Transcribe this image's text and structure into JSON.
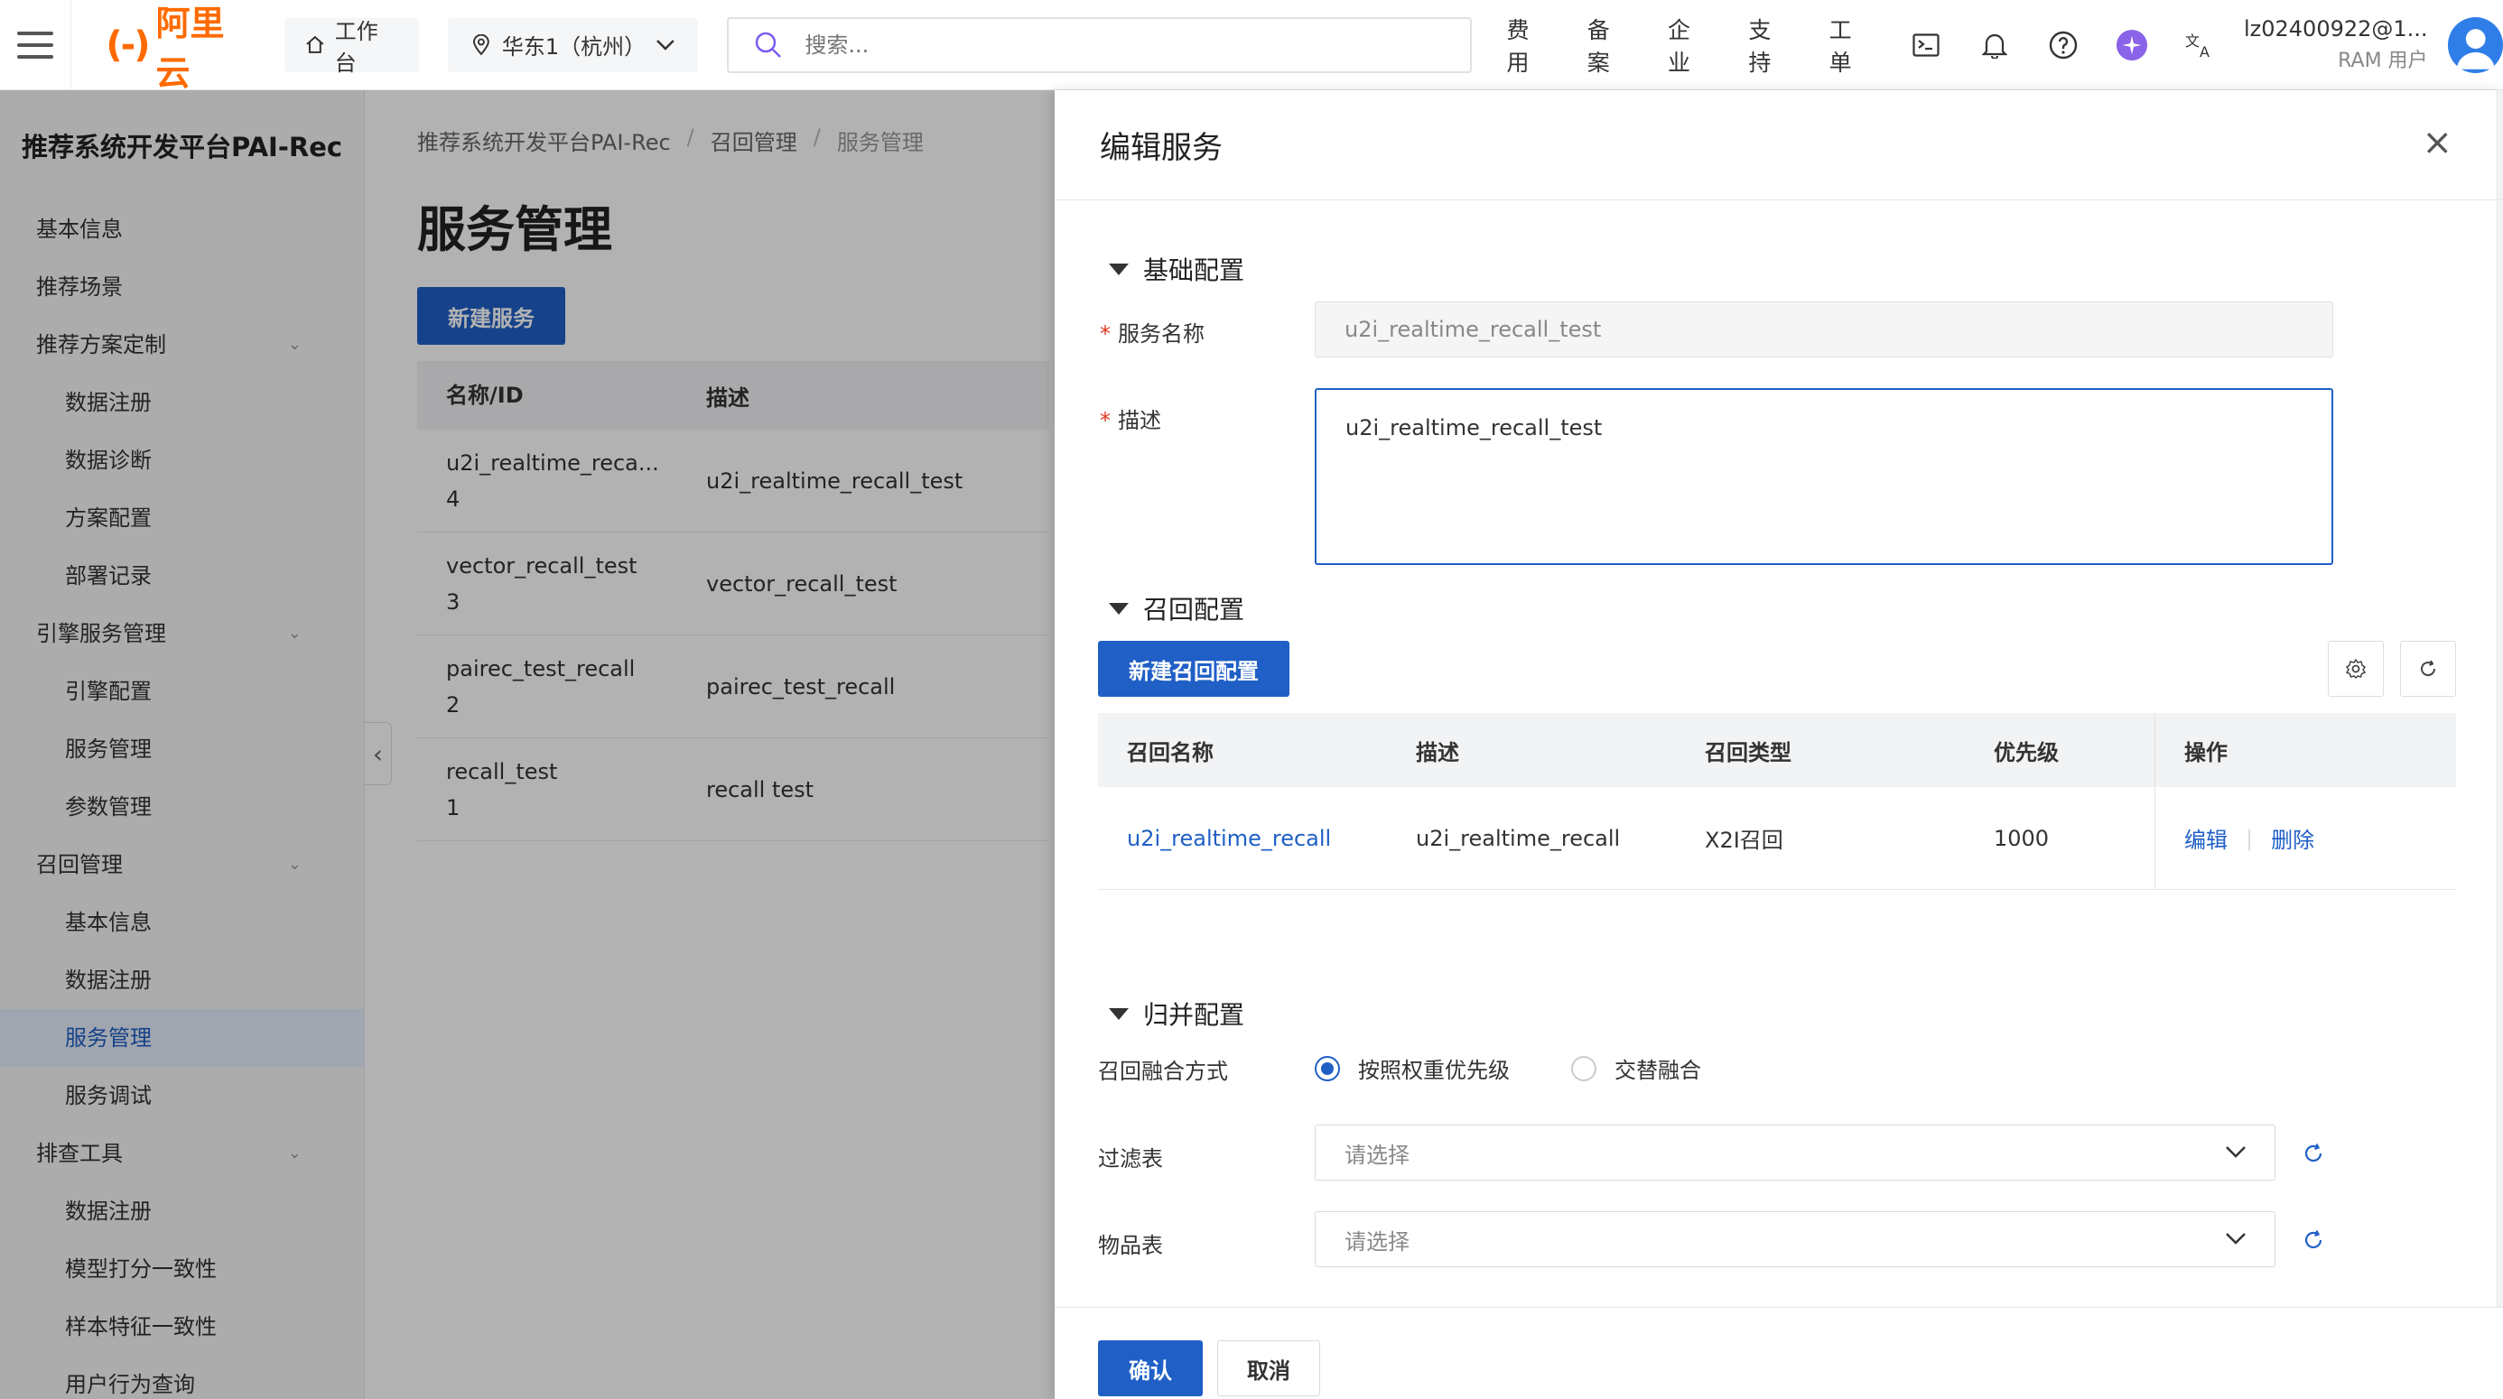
{
  "topbar": {
    "logo_mark": "(-)",
    "logo_text": "阿里云",
    "workbench": "工作台",
    "region": "华东1（杭州）",
    "search_placeholder": "搜索...",
    "nav": [
      "费用",
      "备案",
      "企业",
      "支持",
      "工单"
    ],
    "user_name": "lz02400922@1...",
    "user_role": "RAM 用户"
  },
  "sidebar": {
    "title": "推荐系统开发平台PAI-Rec",
    "items": [
      {
        "label": "基本信息",
        "level": 1
      },
      {
        "label": "推荐场景",
        "level": 1
      },
      {
        "label": "推荐方案定制",
        "level": 1,
        "expanded": true
      },
      {
        "label": "数据注册",
        "level": 2
      },
      {
        "label": "数据诊断",
        "level": 2
      },
      {
        "label": "方案配置",
        "level": 2
      },
      {
        "label": "部署记录",
        "level": 2
      },
      {
        "label": "引擎服务管理",
        "level": 1,
        "expanded": true
      },
      {
        "label": "引擎配置",
        "level": 2
      },
      {
        "label": "服务管理",
        "level": 2
      },
      {
        "label": "参数管理",
        "level": 2
      },
      {
        "label": "召回管理",
        "level": 1,
        "expanded": true
      },
      {
        "label": "基本信息",
        "level": 2
      },
      {
        "label": "数据注册",
        "level": 2
      },
      {
        "label": "服务管理",
        "level": 2,
        "active": true
      },
      {
        "label": "服务调试",
        "level": 2
      },
      {
        "label": "排查工具",
        "level": 1,
        "expanded": true
      },
      {
        "label": "数据注册",
        "level": 2
      },
      {
        "label": "模型打分一致性",
        "level": 2
      },
      {
        "label": "样本特征一致性",
        "level": 2
      },
      {
        "label": "用户行为查询",
        "level": 2
      }
    ]
  },
  "main": {
    "breadcrumb": [
      "推荐系统开发平台PAI-Rec",
      "召回管理",
      "服务管理"
    ],
    "title": "服务管理",
    "new_button": "新建服务",
    "table_headers": [
      "名称/ID",
      "描述"
    ],
    "rows": [
      {
        "name": "u2i_realtime_reca...",
        "id": "4",
        "desc": "u2i_realtime_recall_test"
      },
      {
        "name": "vector_recall_test",
        "id": "3",
        "desc": "vector_recall_test"
      },
      {
        "name": "pairec_test_recall",
        "id": "2",
        "desc": "pairec_test_recall"
      },
      {
        "name": "recall_test",
        "id": "1",
        "desc": "recall test"
      }
    ]
  },
  "drawer": {
    "title": "编辑服务",
    "basic_section": "基础配置",
    "name_label": "服务名称",
    "name_value": "u2i_realtime_recall_test",
    "desc_label": "描述",
    "desc_value": "u2i_realtime_recall_test",
    "recall_section": "召回配置",
    "new_recall_button": "新建召回配置",
    "recall_headers": [
      "召回名称",
      "描述",
      "召回类型",
      "优先级",
      "操作"
    ],
    "recall_rows": [
      {
        "name": "u2i_realtime_recall",
        "desc": "u2i_realtime_recall",
        "type": "X2I召回",
        "priority": "1000",
        "edit": "编辑",
        "delete": "删除"
      }
    ],
    "merge_section": "归并配置",
    "merge_label": "召回融合方式",
    "merge_options": [
      "按照权重优先级",
      "交替融合"
    ],
    "merge_selected": "按照权重优先级",
    "filter_label": "过滤表",
    "filter_placeholder": "请选择",
    "item_label": "物品表",
    "item_placeholder": "请选择",
    "confirm": "确认",
    "cancel": "取消"
  },
  "colors": {
    "brand": "#ff6a00",
    "primary": "#1f5fc6",
    "required": "#e0361c"
  }
}
